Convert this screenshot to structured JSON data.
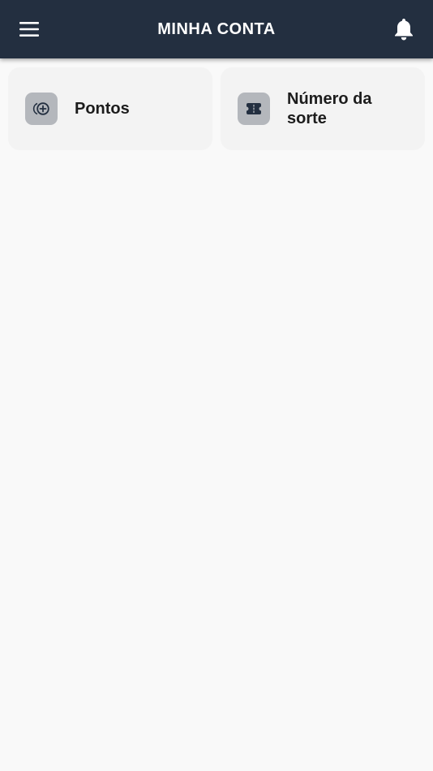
{
  "header": {
    "title": "MINHA CONTA",
    "menu_icon": "hamburger-menu-icon",
    "notification_icon": "bell-icon",
    "background_color": "#232f40"
  },
  "cards": [
    {
      "label": "Pontos",
      "icon": "coin-plus-icon"
    },
    {
      "label": "Número da sorte",
      "icon": "ticket-icon"
    }
  ]
}
